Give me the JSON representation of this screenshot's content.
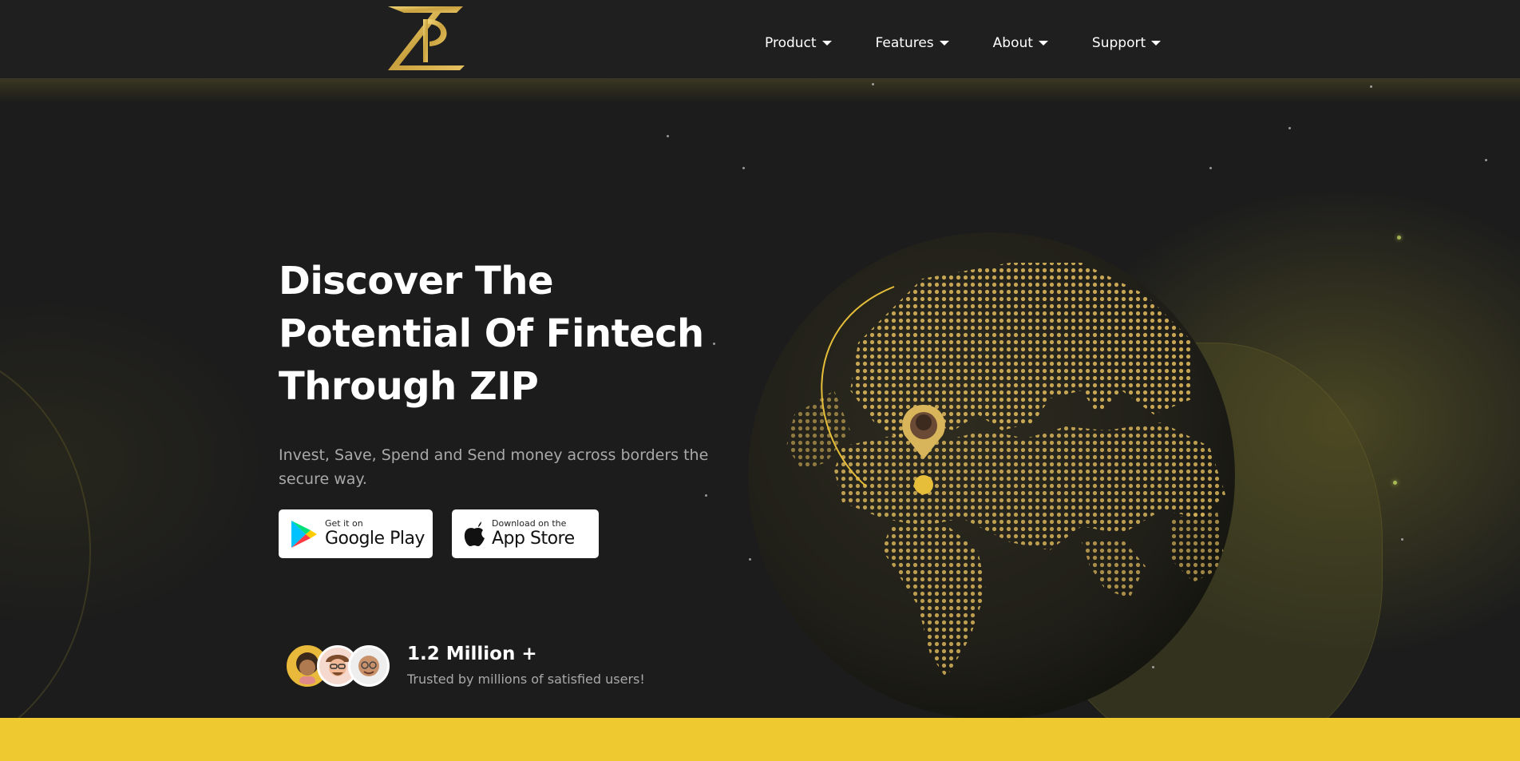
{
  "header": {
    "logo_icon": "zip-logo-icon",
    "nav": [
      {
        "label": "Product"
      },
      {
        "label": "Features"
      },
      {
        "label": "About"
      },
      {
        "label": "Support"
      }
    ]
  },
  "hero": {
    "headline_lines": [
      "Discover The",
      "Potential Of Fintech",
      "Through ZIP"
    ],
    "subtitle": "Invest, Save, Spend and Send money across borders the secure way.",
    "google_play": {
      "small": "Get it on",
      "big": "Google Play",
      "icon": "google-play-icon"
    },
    "app_store": {
      "small": "Download on the",
      "big": "App Store",
      "icon": "apple-icon"
    },
    "stat": {
      "value": "1.2 Million +",
      "label": "Trusted by millions of satisfied users!"
    }
  },
  "colors": {
    "accent": "#eec930",
    "gold": "#c9a545",
    "background": "#1c1c1c"
  }
}
